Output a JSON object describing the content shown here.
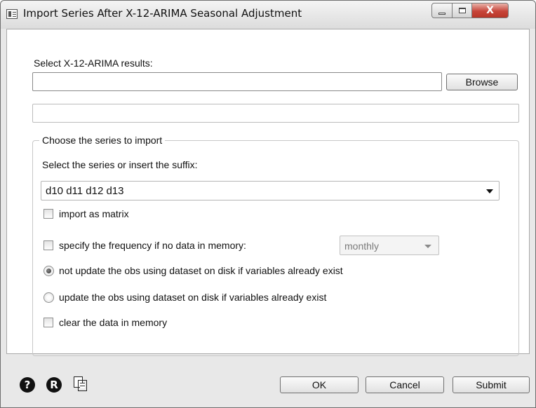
{
  "window": {
    "title": "Import Series After X-12-ARIMA Seasonal Adjustment",
    "close_glyph": "X"
  },
  "results": {
    "label": "Select X-12-ARIMA results:",
    "path_value": "",
    "browse_label": "Browse",
    "info_value": ""
  },
  "series_group": {
    "title": "Choose the series to import",
    "select_label": "Select the series or insert the suffix:",
    "series_value": "d10 d11 d12 d13",
    "import_matrix": {
      "label": "import as matrix",
      "checked": false
    },
    "specify_frequency": {
      "label": "specify the frequency if no data in memory:",
      "checked": false
    },
    "frequency_value": "monthly",
    "not_update": {
      "label": "not update the obs using dataset on disk if variables already exist",
      "selected": true
    },
    "update": {
      "label": "update the obs using dataset on disk if variables already exist",
      "selected": false
    },
    "clear_data": {
      "label": "clear the data in memory",
      "checked": false
    }
  },
  "footer": {
    "help_icon_glyph": "?",
    "reset_icon_glyph": "R",
    "ok_label": "OK",
    "cancel_label": "Cancel",
    "submit_label": "Submit"
  }
}
